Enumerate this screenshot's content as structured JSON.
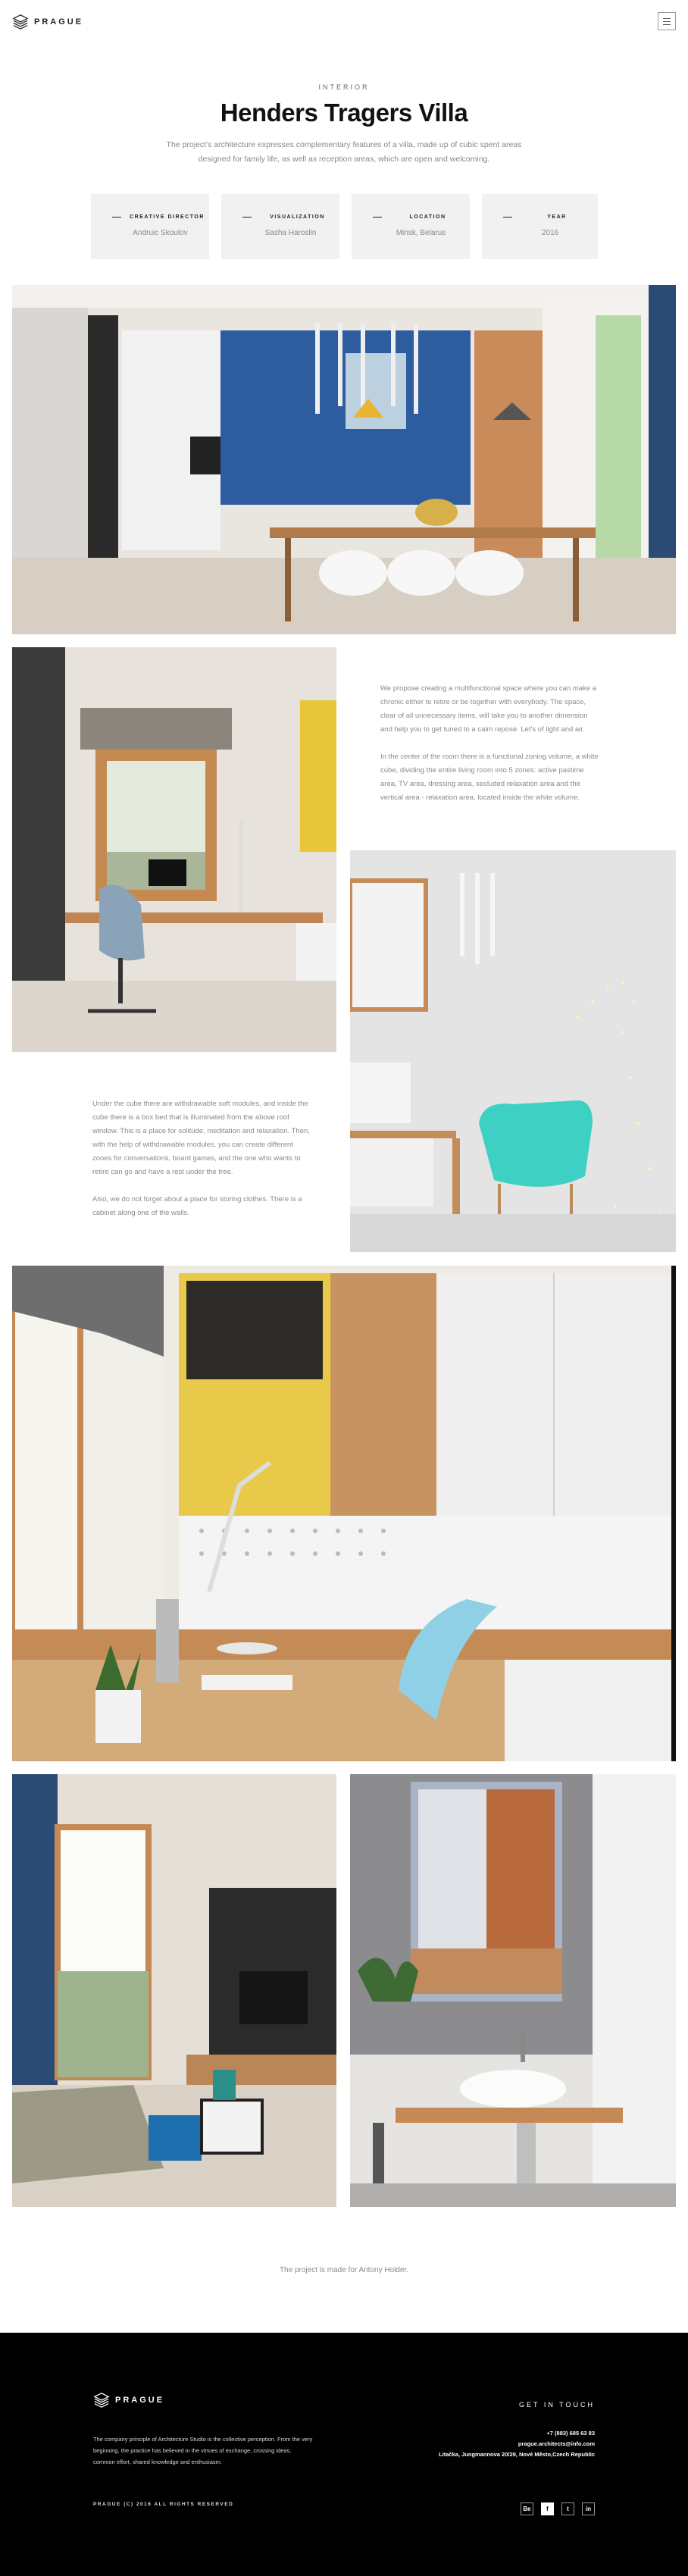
{
  "header": {
    "logo_text": "PRAGUE",
    "menu_icon": "hamburger-menu-icon"
  },
  "hero": {
    "eyebrow": "INTERIOR",
    "title": "Henders Tragers Villa",
    "intro": "The project's architecture expresses complementary features of a villa, made up of cubic spent areas designed for family life, as well as reception areas, which are open and welcoming."
  },
  "info": [
    {
      "label": "CREATIVE DIRECTOR",
      "value": "Andruic Skoulov"
    },
    {
      "label": "VISUALIZATION",
      "value": "Sasha Haroslin"
    },
    {
      "label": "LOCATION",
      "value": "Minsk, Belarus"
    },
    {
      "label": "YEAR",
      "value": "2016"
    }
  ],
  "text_right": {
    "p1": "We propose creating a multifunctional space where you can make a chronic either to retire or be together with everybody. The space, clear of all unnecessary items, will take you to another dimension and help you to get tuned to a calm repose. Let's of light and air.",
    "p2": "In the center of the room there is a functional zoning volume, a white cube, dividing the entire living room into 5 zones: active pastime area, TV area, dressing area, secluded relaxation area and the vertical area - relaxation area, located inside the white volume."
  },
  "text_left": {
    "p1": "Under the cube there are withdrawable soft modules, and inside the cube there is a box bed that is illuminated from the above roof window. This is a place for solitude, meditation and relaxation. Then, with the help of withdrawable modules, you can create different zones for conversations, board games, and the one who wants to retire can go and have a rest under the tree.",
    "p2": "Also, we do not forget about a place for storing clothes. There is a cabinet along one of the walls."
  },
  "credit": "The project is made for Antony Holder.",
  "footer": {
    "logo_text": "PRAGUE",
    "about": "The company principle of Architecture Studio is the collective perception. From the very beginning, the practice has believed in the virtues of exchange, crossing ideas, common effort, shared knowledge and enthusiasm.",
    "copyright": "PRAGUE (C) 2016 ALL RIGHTS RESERVED",
    "get_in_touch": "GET IN TOUCH",
    "phone": "+7 (883) 685 63 83",
    "email": "prague.architects@info.com",
    "address": "Litačka, Jungmannova 20/29, Nové Město,Czech Republic",
    "social": [
      "Be",
      "f",
      "t",
      "in"
    ]
  },
  "colors": {
    "accent_blue": "#2d5d9e",
    "teal_chair": "#3fd0c4",
    "yellow": "#e7c64a",
    "footer_bg": "#000000"
  }
}
